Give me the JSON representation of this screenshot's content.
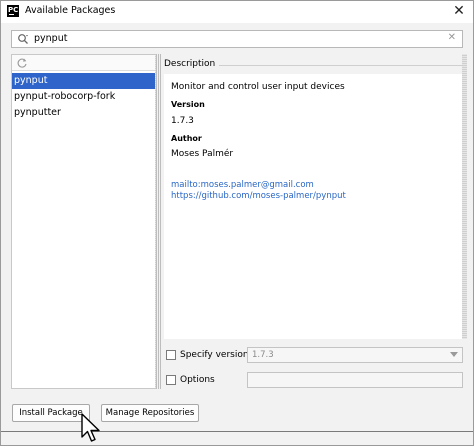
{
  "window": {
    "title": "Available Packages",
    "app_icon_text": "PC",
    "close_symbol": "✕"
  },
  "search": {
    "value": "pynput",
    "clear_symbol": "✕"
  },
  "packages": {
    "items": [
      {
        "label": "pynput",
        "selected": true
      },
      {
        "label": "pynput-robocorp-fork",
        "selected": false
      },
      {
        "label": "pynputter",
        "selected": false
      }
    ]
  },
  "description": {
    "header": "Description",
    "summary": "Monitor and control user input devices",
    "version_label": "Version",
    "version": "1.7.3",
    "author_label": "Author",
    "author": "Moses Palmér",
    "email_link": "mailto:moses.palmer@gmail.com",
    "url_link": "https://github.com/moses-palmer/pynput"
  },
  "options": {
    "specify_version_label": "Specify version",
    "specify_version_checked": false,
    "version_value": "1.7.3",
    "options_label": "Options",
    "options_checked": false,
    "options_value": ""
  },
  "buttons": {
    "install": "Install Package",
    "manage": "Manage Repositories"
  },
  "colors": {
    "selection": "#2f65ca",
    "link": "#2a67c5"
  },
  "icons": {
    "app": "pycharm-logo-icon",
    "search": "search-icon",
    "refresh": "refresh-icon",
    "cursor": "mouse-pointer-icon"
  }
}
